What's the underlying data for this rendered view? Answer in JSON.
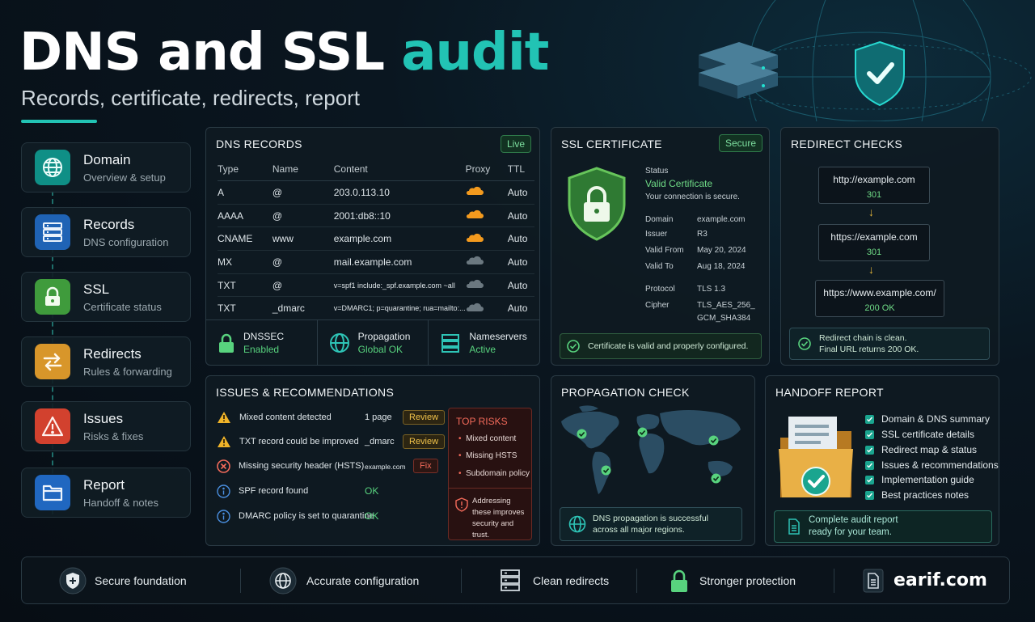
{
  "header": {
    "title_main": "DNS and SSL",
    "title_accent": "audit",
    "subtitle": "Records, certificate, redirects, report"
  },
  "colors": {
    "accent": "#22c3b4",
    "ok": "#58d37e",
    "warn": "#f0c24a",
    "danger": "#f26a5a"
  },
  "nav": [
    {
      "label": "Domain",
      "sub": "Overview & setup",
      "icon": "globe-icon"
    },
    {
      "label": "Records",
      "sub": "DNS configuration",
      "icon": "server-list-icon"
    },
    {
      "label": "SSL",
      "sub": "Certificate status",
      "icon": "lock-icon"
    },
    {
      "label": "Redirects",
      "sub": "Rules & forwarding",
      "icon": "swap-arrows-icon"
    },
    {
      "label": "Issues",
      "sub": "Risks & fixes",
      "icon": "warning-icon"
    },
    {
      "label": "Report",
      "sub": "Handoff & notes",
      "icon": "folder-icon"
    }
  ],
  "dns": {
    "title": "DNS RECORDS",
    "badge": "Live",
    "columns": [
      "Type",
      "Name",
      "Content",
      "Proxy",
      "TTL"
    ],
    "rows": [
      {
        "type": "A",
        "name": "@",
        "content": "203.0.113.10",
        "ttl": "Auto"
      },
      {
        "type": "AAAA",
        "name": "@",
        "content": "2001:db8::10",
        "ttl": "Auto"
      },
      {
        "type": "CNAME",
        "name": "www",
        "content": "example.com",
        "ttl": "Auto"
      },
      {
        "type": "MX",
        "name": "@",
        "content": "mail.example.com",
        "ttl": "Auto"
      },
      {
        "type": "TXT",
        "name": "@",
        "content": "v=spf1 include:_spf.example.com ~all",
        "ttl": "Auto"
      },
      {
        "type": "TXT",
        "name": "_dmarc",
        "content": "v=DMARC1; p=quarantine; rua=mailto:...",
        "ttl": "Auto"
      }
    ],
    "footer": [
      {
        "label": "DNSSEC",
        "value": "Enabled"
      },
      {
        "label": "Propagation",
        "value": "Global OK"
      },
      {
        "label": "Nameservers",
        "value": "Active"
      }
    ]
  },
  "ssl": {
    "title": "SSL CERTIFICATE",
    "badge": "Secure",
    "status_label": "Status",
    "status_value": "Valid Certificate",
    "status_note": "Your connection is secure.",
    "fields": [
      {
        "k": "Domain",
        "v": "example.com"
      },
      {
        "k": "Issuer",
        "v": "R3"
      },
      {
        "k": "Valid From",
        "v": "May 20, 2024"
      },
      {
        "k": "Valid To",
        "v": "Aug 18, 2024"
      },
      {
        "k": "Protocol",
        "v": "TLS 1.3"
      },
      {
        "k": "Cipher",
        "v": "TLS_AES_256_",
        "v2": "GCM_SHA384"
      }
    ],
    "footer_note": "Certificate is valid and properly configured."
  },
  "redirects": {
    "title": "REDIRECT CHECKS",
    "steps": [
      {
        "url": "http://example.com",
        "code": "301"
      },
      {
        "url": "https://example.com",
        "code": "301"
      },
      {
        "url": "https://www.example.com/",
        "code": "200 OK"
      }
    ],
    "note1": "Redirect chain is clean.",
    "note2": "Final URL returns 200 OK."
  },
  "issues": {
    "title": "ISSUES & RECOMMENDATIONS",
    "items": [
      {
        "name": "Mixed content detected",
        "detail": "1 page",
        "action": "Review"
      },
      {
        "name": "TXT record could be improved",
        "detail": "_dmarc",
        "action": "Review"
      },
      {
        "name": "Missing security header (HSTS)",
        "detail": "example.com",
        "action": "Fix"
      },
      {
        "name": "SPF record found",
        "status": "OK"
      },
      {
        "name": "DMARC policy is set to quarantine",
        "status": "OK"
      }
    ],
    "top_risks_title": "TOP RISKS",
    "top_risks": [
      "Mixed content",
      "Missing HSTS",
      "Subdomain policy"
    ],
    "risk_note": "Addressing these improves security and trust."
  },
  "propagation": {
    "title": "PROPAGATION CHECK",
    "note1": "DNS propagation is successful",
    "note2": "across all major regions."
  },
  "report": {
    "title": "HANDOFF REPORT",
    "items": [
      "Domain & DNS summary",
      "SSL certificate details",
      "Redirect map & status",
      "Issues & recommendations",
      "Implementation guide",
      "Best practices notes"
    ],
    "note1": "Complete audit report",
    "note2": "ready for your team."
  },
  "footer": {
    "items": [
      "Secure foundation",
      "Accurate configuration",
      "Clean redirects",
      "Stronger protection"
    ],
    "brand": "earif.com"
  }
}
